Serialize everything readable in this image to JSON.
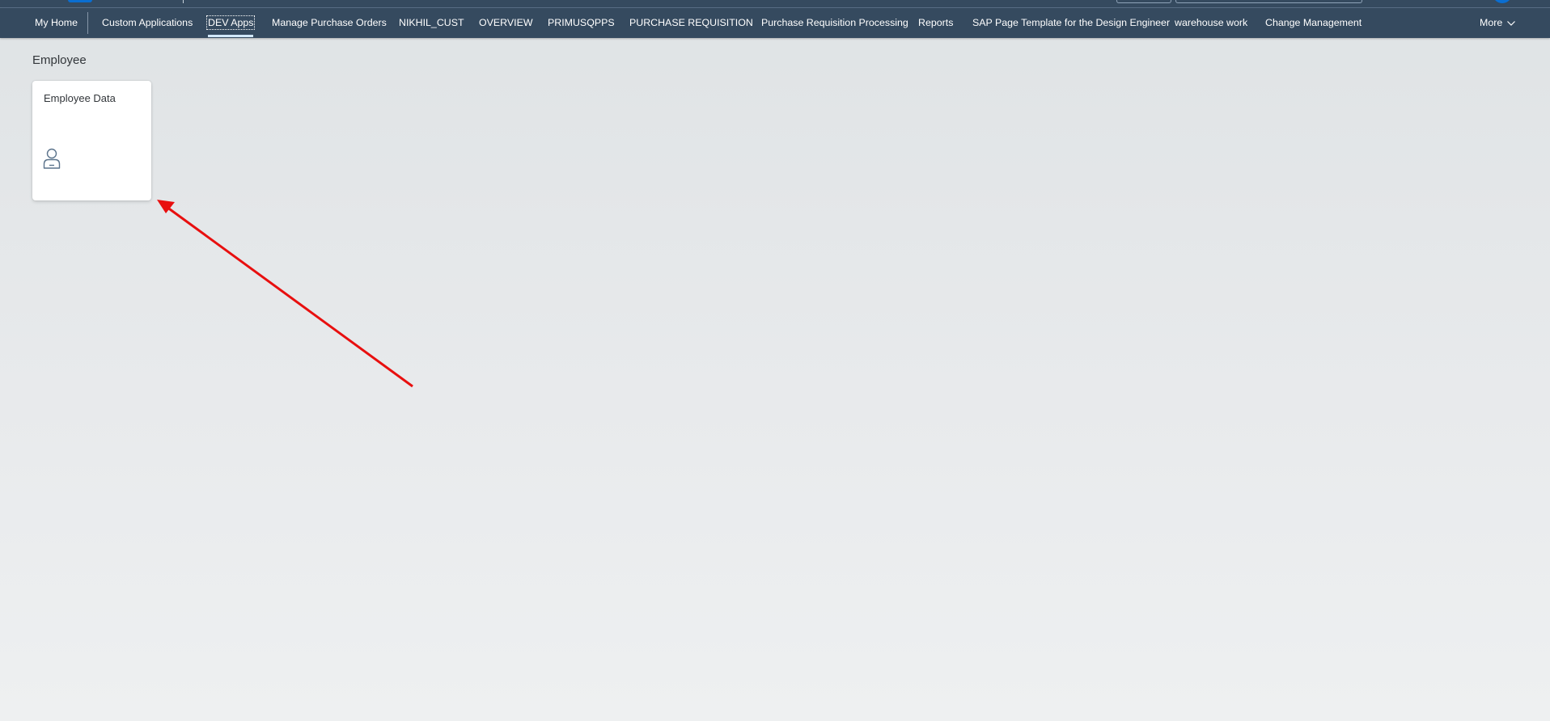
{
  "nav": {
    "items": [
      {
        "label": "My Home"
      },
      {
        "label": "Custom Applications"
      },
      {
        "label": "DEV Apps"
      },
      {
        "label": "Manage Purchase Orders"
      },
      {
        "label": "NIKHIL_CUST"
      },
      {
        "label": "OVERVIEW"
      },
      {
        "label": "PRIMUSQPPS"
      },
      {
        "label": "PURCHASE REQUISITION"
      },
      {
        "label": "Purchase Requisition Processing"
      },
      {
        "label": "Reports"
      },
      {
        "label": "SAP Page Template for the Design Engineer"
      },
      {
        "label": "warehouse work"
      },
      {
        "label": "Change Management"
      }
    ],
    "more_label": "More",
    "more_icon": "chevron-down-icon"
  },
  "group": {
    "title": "Employee"
  },
  "tile": {
    "title": "Employee Data",
    "icon": "employee-icon"
  },
  "colors": {
    "shell": "#354a5f",
    "accent": "#0a6ed1",
    "tile_icon": "#5b738b",
    "annotation_arrow": "#e80f0f"
  }
}
